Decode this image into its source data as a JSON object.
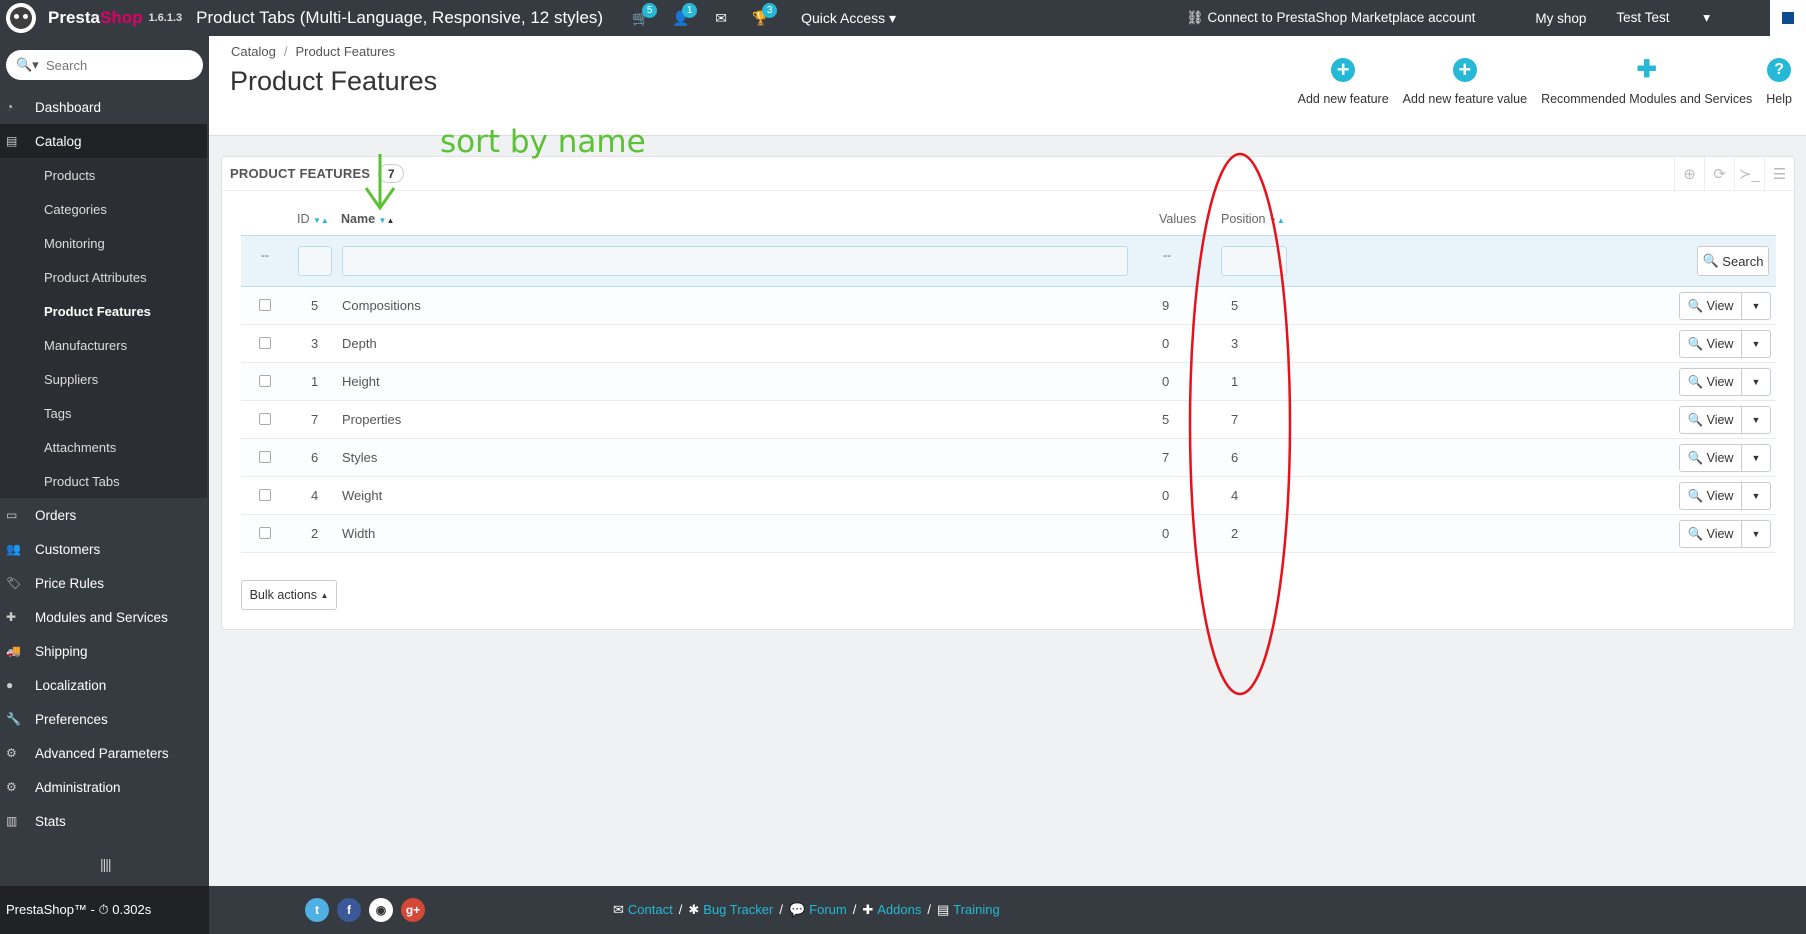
{
  "topbar": {
    "brand_a": "Presta",
    "brand_b": "Shop",
    "version": "1.6.1.3",
    "shop_title": "Product Tabs (Multi-Language, Responsive, 12 styles)",
    "badges": {
      "cart": "5",
      "user": "1",
      "trophy": "3"
    },
    "quick_access": "Quick Access",
    "marketplace": "Connect to PrestaShop Marketplace account",
    "my_shop": "My shop",
    "user": "Test Test"
  },
  "sidebar": {
    "search_placeholder": "Search",
    "items": [
      {
        "label": "Dashboard",
        "icon": "dashboard-icon"
      },
      {
        "label": "Catalog",
        "icon": "book-icon"
      },
      {
        "label": "Orders",
        "icon": "credit-card-icon"
      },
      {
        "label": "Customers",
        "icon": "users-icon"
      },
      {
        "label": "Price Rules",
        "icon": "tags-icon"
      },
      {
        "label": "Modules and Services",
        "icon": "puzzle-icon"
      },
      {
        "label": "Shipping",
        "icon": "truck-icon"
      },
      {
        "label": "Localization",
        "icon": "globe-icon"
      },
      {
        "label": "Preferences",
        "icon": "wrench-icon"
      },
      {
        "label": "Advanced Parameters",
        "icon": "cogs-icon"
      },
      {
        "label": "Administration",
        "icon": "cog-icon"
      },
      {
        "label": "Stats",
        "icon": "bar-chart-icon"
      }
    ],
    "catalog_sub": [
      "Products",
      "Categories",
      "Monitoring",
      "Product Attributes",
      "Product Features",
      "Manufacturers",
      "Suppliers",
      "Tags",
      "Attachments",
      "Product Tabs"
    ]
  },
  "header": {
    "breadcrumb": [
      "Catalog",
      "Product Features"
    ],
    "title": "Product Features",
    "toolbar": [
      "Add new feature",
      "Add new feature value",
      "Recommended Modules and Services",
      "Help"
    ]
  },
  "panel": {
    "title": "PRODUCT FEATURES",
    "count": "7",
    "columns": {
      "id": "ID",
      "name": "Name",
      "values": "Values",
      "position": "Position"
    },
    "filter_dash": "--",
    "search_label": "Search",
    "view_label": "View",
    "bulk_label": "Bulk actions",
    "rows": [
      {
        "id": "5",
        "name": "Compositions",
        "values": "9",
        "position": "5"
      },
      {
        "id": "3",
        "name": "Depth",
        "values": "0",
        "position": "3"
      },
      {
        "id": "1",
        "name": "Height",
        "values": "0",
        "position": "1"
      },
      {
        "id": "7",
        "name": "Properties",
        "values": "5",
        "position": "7"
      },
      {
        "id": "6",
        "name": "Styles",
        "values": "7",
        "position": "6"
      },
      {
        "id": "4",
        "name": "Weight",
        "values": "0",
        "position": "4"
      },
      {
        "id": "2",
        "name": "Width",
        "values": "0",
        "position": "2"
      }
    ]
  },
  "annotation": {
    "text": "sort by name"
  },
  "footer": {
    "left": "PrestaShop™ - ⏱ 0.302s",
    "links": [
      "Contact",
      "Bug Tracker",
      "Forum",
      "Addons",
      "Training"
    ]
  },
  "colors": {
    "accent": "#25b9d7",
    "dark": "#363a41",
    "annotation_green": "#5bc236",
    "annotation_red": "#e8101a"
  }
}
